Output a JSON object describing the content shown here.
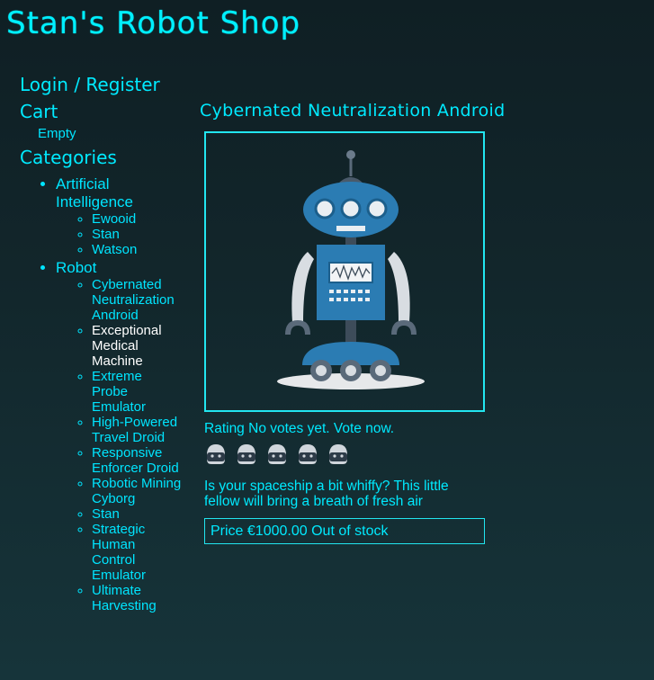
{
  "site": {
    "title": "Stan's Robot Shop"
  },
  "sidebar": {
    "login": "Login / Register",
    "cart": {
      "label": "Cart",
      "status": "Empty"
    },
    "categories_label": "Categories",
    "categories": [
      {
        "name": "Artificial Intelligence",
        "items": [
          "Ewooid",
          "Stan",
          "Watson"
        ]
      },
      {
        "name": "Robot",
        "items": [
          "Cybernated Neutralization Android",
          "Exceptional Medical Machine",
          "Extreme Probe Emulator",
          "High-Powered Travel Droid",
          "Responsive Enforcer Droid",
          "Robotic Mining Cyborg",
          "Stan",
          "Strategic Human Control Emulator",
          "Ultimate Harvesting"
        ],
        "active_index": 1
      }
    ]
  },
  "product": {
    "name": "Cybernated Neutralization Android",
    "rating_label": "Rating",
    "rating_text": "No votes yet. Vote now.",
    "star_count": 5,
    "description": "Is your spaceship a bit whiffy? This little fellow will bring a breath of fresh air",
    "price_label": "Price",
    "price": "€1000.00",
    "stock": "Out of stock"
  },
  "colors": {
    "accent": "#00eaff",
    "active_link": "#ffffff",
    "robot_blue": "#2b7cb3",
    "background": "#12262b"
  }
}
